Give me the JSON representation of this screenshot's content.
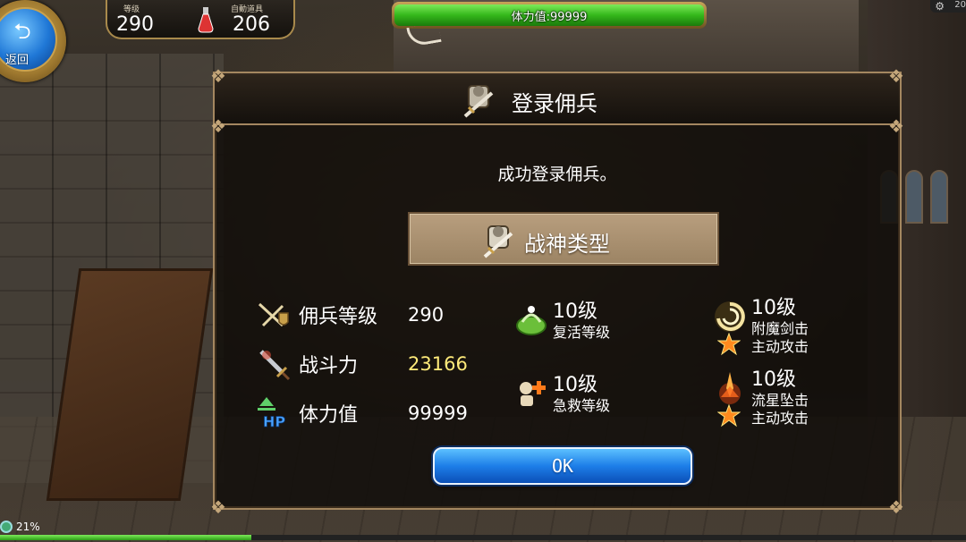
{
  "hud": {
    "back_label": "返回",
    "level_caption": "等级",
    "level_value": "290",
    "auto_item_caption": "自動道具",
    "auto_item_value": "206",
    "stamina_text": "体力值:99999",
    "corner_value": "20",
    "battery_text": "21%",
    "progress": 0.26
  },
  "dialog": {
    "title": "登录佣兵",
    "success_message": "成功登录佣兵。",
    "type_label": "战神类型",
    "stats": [
      {
        "label": "佣兵等级",
        "value": "290"
      },
      {
        "label": "战斗力",
        "value": "23166"
      },
      {
        "label": "体力值",
        "value": "99999"
      }
    ],
    "skills": [
      {
        "level": "10级",
        "name": "复活等级",
        "icon": "revive-icon"
      },
      {
        "level": "10级",
        "name": "急救等级",
        "icon": "first-aid-icon"
      },
      {
        "level": "10级",
        "name": "附魔剑击",
        "tag": "主动攻击",
        "icon": "whirlwind-icon"
      },
      {
        "level": "10级",
        "name": "流星坠击",
        "tag": "主动攻击",
        "icon": "meteor-icon"
      }
    ],
    "ok_label": "OK"
  },
  "colors": {
    "power_value": "#ffeb7a",
    "ok_button": "#1d7ee8",
    "stamina_bar": "#34b81b",
    "frame_gold": "#a48760"
  }
}
